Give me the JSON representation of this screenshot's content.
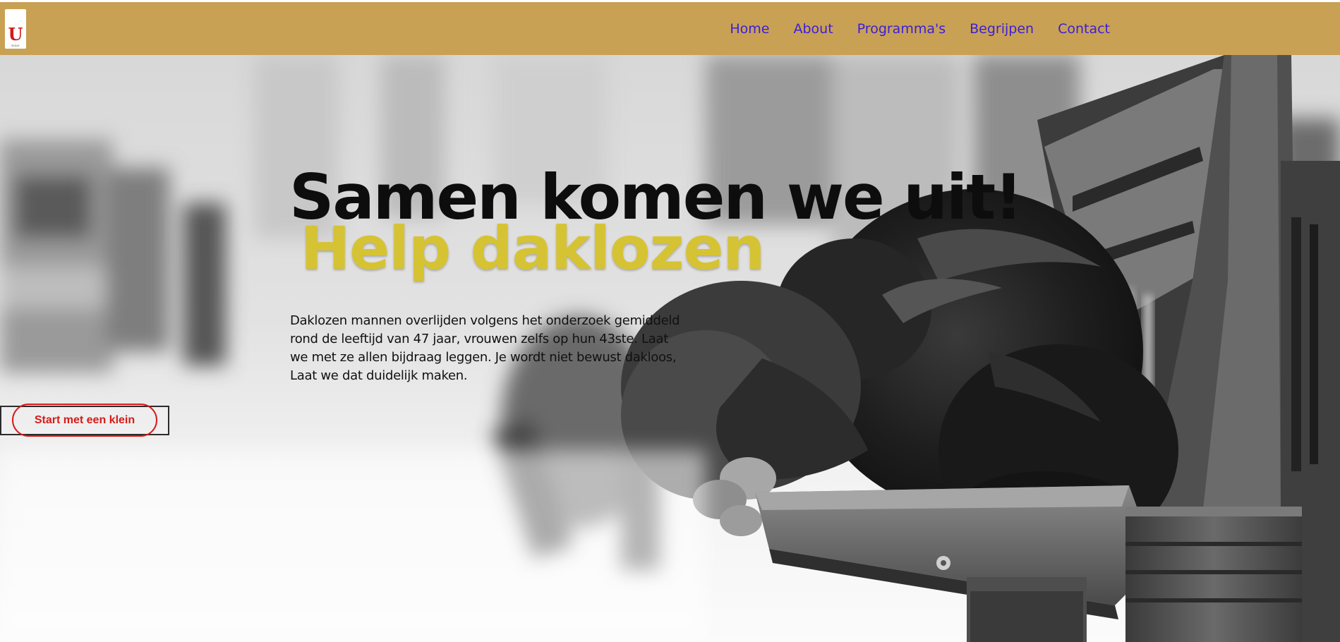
{
  "header": {
    "logo": {
      "letter": "U",
      "small_text": "SIDO",
      "brand_color": "#d21a1a"
    },
    "nav": [
      {
        "label": "Home"
      },
      {
        "label": "About"
      },
      {
        "label": "Programma's"
      },
      {
        "label": "Begrijpen"
      },
      {
        "label": "Contact"
      }
    ],
    "bar_color": "#c9a155",
    "link_color": "#3a1fd8"
  },
  "hero": {
    "headline": "Samen komen we uit!",
    "subheadline": "Help daklozen",
    "subheadline_color": "#d6c334",
    "intro": "Daklozen mannen overlijden volgens het onderzoek gemiddeld rond de leeftijd van 47 jaar, vrouwen zelfs op hun 43ste. Laat we met ze allen bijdraag leggen. Je wordt niet bewust dakloos, Laat we dat duidelijk maken.",
    "cta_label": "Start met een klein",
    "cta_color": "#d71a1a",
    "background_image": "homeless-person-sleeping-on-bench-photo"
  }
}
